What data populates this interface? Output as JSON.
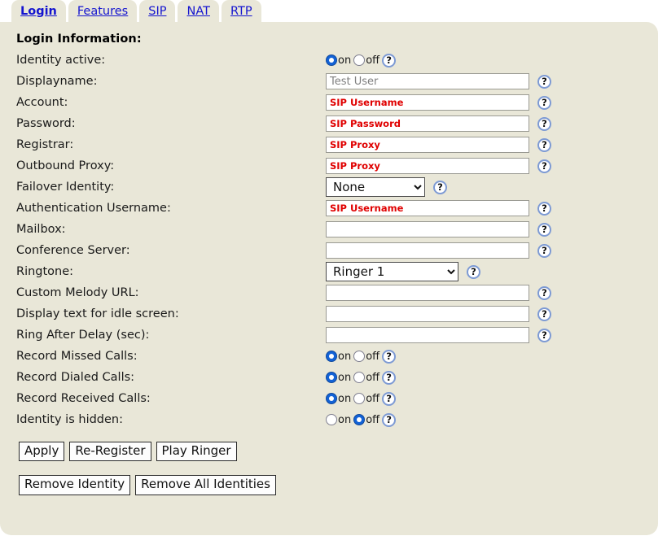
{
  "tabs": [
    {
      "label": "Login",
      "active": true
    },
    {
      "label": "Features",
      "active": false
    },
    {
      "label": "SIP",
      "active": false
    },
    {
      "label": "NAT",
      "active": false
    },
    {
      "label": "RTP",
      "active": false
    }
  ],
  "section": {
    "heading": "Login Information:"
  },
  "help_glyph": "?",
  "radio_on_label": "on",
  "radio_off_label": "off",
  "rows": [
    {
      "label": "Identity active:",
      "type": "radio",
      "value": "on"
    },
    {
      "label": "Displayname:",
      "type": "text",
      "value": "",
      "placeholder": "Test User",
      "required": false
    },
    {
      "label": "Account:",
      "type": "text",
      "value": "",
      "placeholder": "SIP Username",
      "required": true
    },
    {
      "label": "Password:",
      "type": "text",
      "value": "",
      "placeholder": "SIP Password",
      "required": true
    },
    {
      "label": "Registrar:",
      "type": "text",
      "value": "",
      "placeholder": "SIP Proxy",
      "required": true
    },
    {
      "label": "Outbound Proxy:",
      "type": "text",
      "value": "",
      "placeholder": "SIP Proxy",
      "required": true
    },
    {
      "label": "Failover Identity:",
      "type": "select",
      "value": "None",
      "options": [
        "None"
      ],
      "width": "narrow"
    },
    {
      "label": "Authentication Username:",
      "type": "text",
      "value": "",
      "placeholder": "SIP Username",
      "required": true
    },
    {
      "label": "Mailbox:",
      "type": "text",
      "value": "",
      "placeholder": "",
      "required": false
    },
    {
      "label": "Conference Server:",
      "type": "text",
      "value": "",
      "placeholder": "",
      "required": false
    },
    {
      "label": "Ringtone:",
      "type": "select",
      "value": "Ringer 1",
      "options": [
        "Ringer 1"
      ],
      "width": "wide"
    },
    {
      "label": "Custom Melody URL:",
      "type": "text",
      "value": "",
      "placeholder": "",
      "required": false
    },
    {
      "label": "Display text for idle screen:",
      "type": "text",
      "value": "",
      "placeholder": "",
      "required": false
    },
    {
      "label": "Ring After Delay (sec):",
      "type": "text",
      "value": "",
      "placeholder": "",
      "required": false
    },
    {
      "label": "Record Missed Calls:",
      "type": "radio",
      "value": "on"
    },
    {
      "label": "Record Dialed Calls:",
      "type": "radio",
      "value": "on"
    },
    {
      "label": "Record Received Calls:",
      "type": "radio",
      "value": "on"
    },
    {
      "label": "Identity is hidden:",
      "type": "radio",
      "value": "off"
    }
  ],
  "buttons_primary": [
    {
      "label": "Apply"
    },
    {
      "label": "Re-Register"
    },
    {
      "label": "Play Ringer"
    }
  ],
  "buttons_secondary": [
    {
      "label": "Remove Identity"
    },
    {
      "label": "Remove All Identities"
    }
  ],
  "colors": {
    "panel_bg": "#e9e7d8",
    "link": "#1414cf",
    "required_text": "#e00000",
    "radio_checked": "#1262d6",
    "help_ring": "#7d9ad4"
  }
}
